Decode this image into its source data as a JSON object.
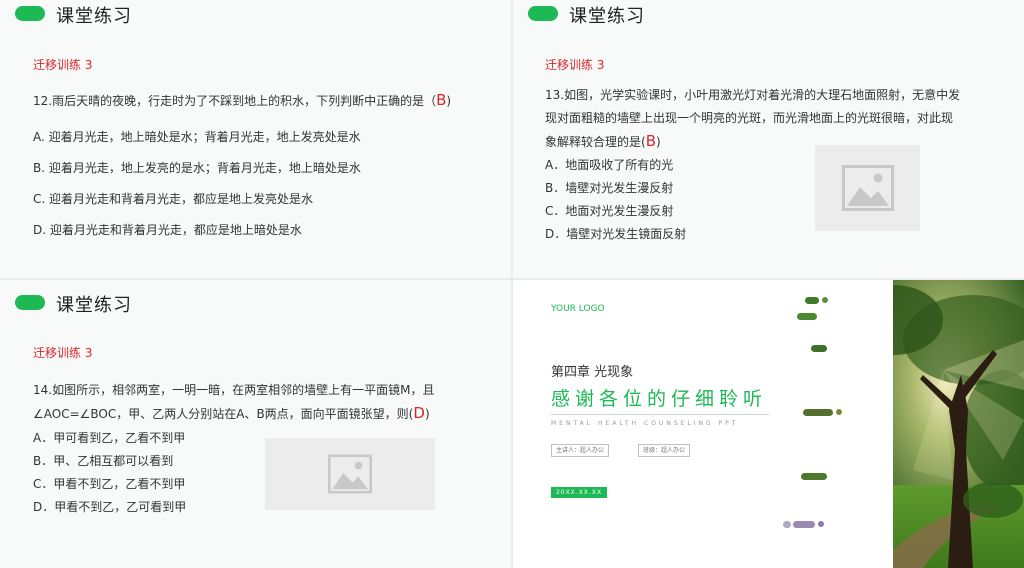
{
  "slides": [
    {
      "title": "课堂练习",
      "subtitle": "迁移训练 3",
      "question": "12.雨后天晴的夜晚，行走时为了不踩到地上的积水，下列判断中正确的是（",
      "answer": "B",
      "answer_close": ")",
      "options": [
        "A. 迎着月光走，地上暗处是水；背着月光走，地上发亮处是水",
        "B. 迎着月光走，地上发亮的是水；背着月光走，地上暗处是水",
        "C. 迎着月光走和背着月光走，都应是地上发亮处是水",
        "D. 迎着月光走和背着月光走，都应是地上暗处是水"
      ]
    },
    {
      "title": "课堂练习",
      "subtitle": "迁移训练 3",
      "question_lines": [
        "13.如图，光学实验课时，小叶用激光灯对着光滑的大理石地面照射，无意中发",
        "现对面粗糙的墙壁上出现一个明亮的光斑，而光滑地面上的光斑很暗，对此现",
        "象解释较合理的是("
      ],
      "answer": "B",
      "answer_close": ")",
      "options": [
        "A．地面吸收了所有的光",
        "B．墙壁对光发生漫反射",
        "C．地面对光发生漫反射",
        "D．墙壁对光发生镜面反射"
      ]
    },
    {
      "title": "课堂练习",
      "subtitle": "迁移训练 3",
      "question_lines": [
        "14.如图所示，相邻两室，一明一暗，在两室相邻的墙壁上有一平面镜M，且",
        "∠AOC=∠BOC，甲、乙两人分别站在A、B两点，面向平面镜张望，则("
      ],
      "answer": "D",
      "answer_close": ")",
      "options": [
        "A．甲可看到乙，乙看不到甲",
        "B．甲、乙相互都可以看到",
        "C．甲看不到乙，乙看不到甲",
        "D．甲看不到乙，乙可看到甲"
      ]
    },
    {
      "logo": "YOUR LOGO",
      "chapter": "第四章 光现象",
      "thanks": "感谢各位的仔细聆听",
      "english": "MENTAL HEALTH COUNSELING PPT",
      "speaker": "主讲人：超人办公",
      "class": "班级：超人办公",
      "date": "20XX.XX.XX"
    }
  ],
  "colors": {
    "accent": "#1db954",
    "answer": "#d9262b"
  },
  "icons": [
    "image-placeholder-icon"
  ]
}
